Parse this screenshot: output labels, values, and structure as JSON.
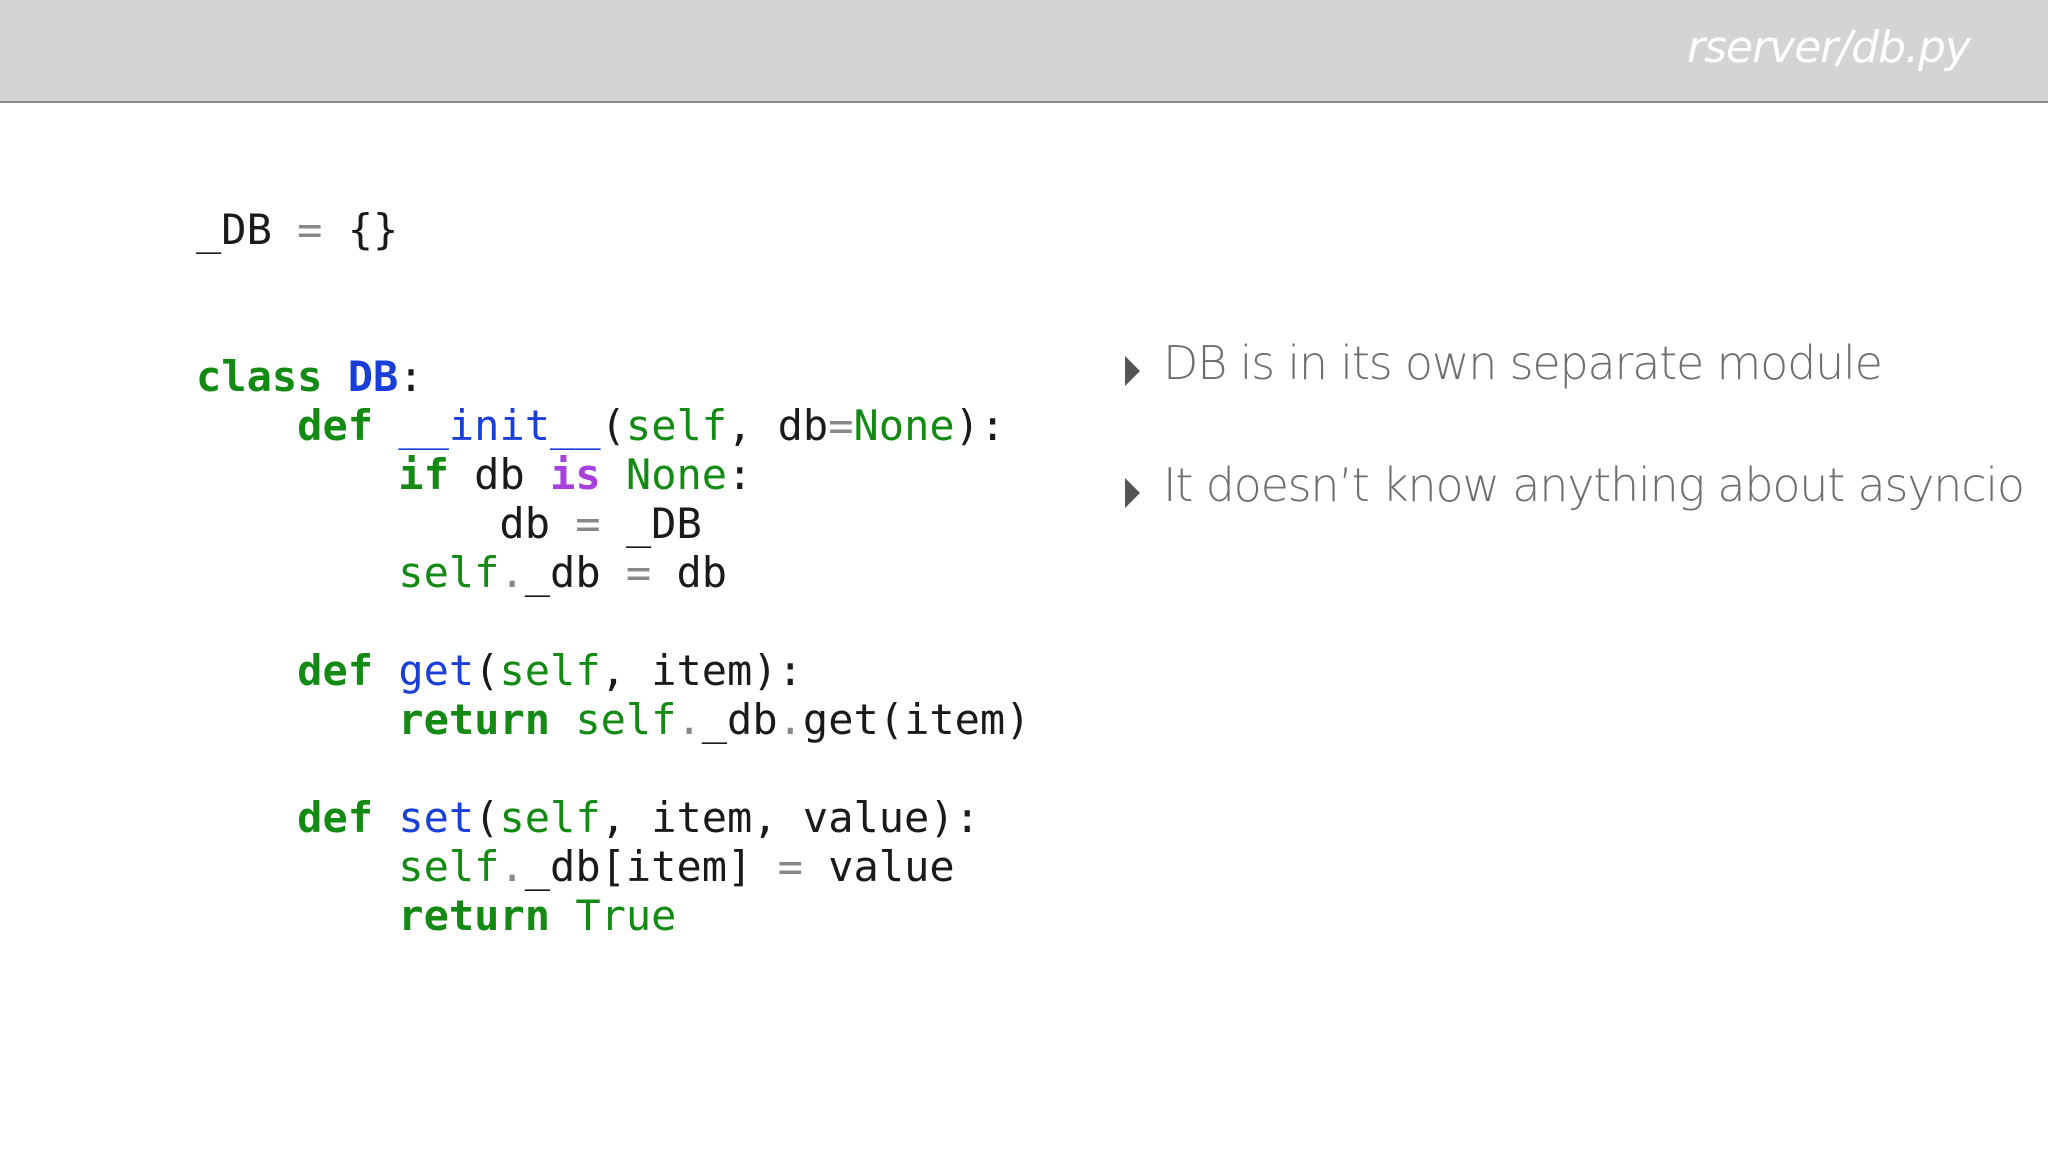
{
  "header": {
    "file_path": "rserver/db.py"
  },
  "code": {
    "language": "python",
    "lines": [
      [
        {
          "t": "_DB",
          "k": "var"
        },
        {
          "t": " ",
          "k": "var"
        },
        {
          "t": "=",
          "k": "op"
        },
        {
          "t": " {}",
          "k": "pun"
        }
      ],
      [],
      [],
      [
        {
          "t": "class",
          "k": "kw"
        },
        {
          "t": " ",
          "k": "var"
        },
        {
          "t": "DB",
          "k": "cls"
        },
        {
          "t": ":",
          "k": "pun"
        }
      ],
      [
        {
          "t": "    ",
          "k": "var"
        },
        {
          "t": "def",
          "k": "kw"
        },
        {
          "t": " ",
          "k": "var"
        },
        {
          "t": "__init__",
          "k": "fn"
        },
        {
          "t": "(",
          "k": "pun"
        },
        {
          "t": "self",
          "k": "bi"
        },
        {
          "t": ", db",
          "k": "pun"
        },
        {
          "t": "=",
          "k": "op"
        },
        {
          "t": "None",
          "k": "bi"
        },
        {
          "t": "):",
          "k": "pun"
        }
      ],
      [
        {
          "t": "        ",
          "k": "var"
        },
        {
          "t": "if",
          "k": "kw"
        },
        {
          "t": " db ",
          "k": "var"
        },
        {
          "t": "is",
          "k": "opw"
        },
        {
          "t": " ",
          "k": "var"
        },
        {
          "t": "None",
          "k": "bi"
        },
        {
          "t": ":",
          "k": "pun"
        }
      ],
      [
        {
          "t": "            db ",
          "k": "var"
        },
        {
          "t": "=",
          "k": "op"
        },
        {
          "t": " _DB",
          "k": "var"
        }
      ],
      [
        {
          "t": "        ",
          "k": "var"
        },
        {
          "t": "self",
          "k": "bi"
        },
        {
          "t": ".",
          "k": "op"
        },
        {
          "t": "_db ",
          "k": "var"
        },
        {
          "t": "=",
          "k": "op"
        },
        {
          "t": " db",
          "k": "var"
        }
      ],
      [],
      [
        {
          "t": "    ",
          "k": "var"
        },
        {
          "t": "def",
          "k": "kw"
        },
        {
          "t": " ",
          "k": "var"
        },
        {
          "t": "get",
          "k": "fn"
        },
        {
          "t": "(",
          "k": "pun"
        },
        {
          "t": "self",
          "k": "bi"
        },
        {
          "t": ", item):",
          "k": "pun"
        }
      ],
      [
        {
          "t": "        ",
          "k": "var"
        },
        {
          "t": "return",
          "k": "kw"
        },
        {
          "t": " ",
          "k": "var"
        },
        {
          "t": "self",
          "k": "bi"
        },
        {
          "t": ".",
          "k": "op"
        },
        {
          "t": "_db",
          "k": "var"
        },
        {
          "t": ".",
          "k": "op"
        },
        {
          "t": "get(item)",
          "k": "var"
        }
      ],
      [],
      [
        {
          "t": "    ",
          "k": "var"
        },
        {
          "t": "def",
          "k": "kw"
        },
        {
          "t": " ",
          "k": "var"
        },
        {
          "t": "set",
          "k": "fn"
        },
        {
          "t": "(",
          "k": "pun"
        },
        {
          "t": "self",
          "k": "bi"
        },
        {
          "t": ", item, value):",
          "k": "pun"
        }
      ],
      [
        {
          "t": "        ",
          "k": "var"
        },
        {
          "t": "self",
          "k": "bi"
        },
        {
          "t": ".",
          "k": "op"
        },
        {
          "t": "_db[item] ",
          "k": "var"
        },
        {
          "t": "=",
          "k": "op"
        },
        {
          "t": " value",
          "k": "var"
        }
      ],
      [
        {
          "t": "        ",
          "k": "var"
        },
        {
          "t": "return",
          "k": "kw"
        },
        {
          "t": " ",
          "k": "var"
        },
        {
          "t": "True",
          "k": "bi"
        }
      ]
    ]
  },
  "bullets": {
    "items": [
      {
        "text": "DB is in its own separate module"
      },
      {
        "text": "It doesn’t know anything about asyncio"
      }
    ]
  },
  "colors": {
    "keyword": "#138a13",
    "function_name": "#1a3fd8",
    "operator": "#888888",
    "operator_word": "#a840e0",
    "builtin": "#138a13",
    "header_bg": "#d4d4d4",
    "bullet_text": "#6e6e6e"
  },
  "icons": {
    "bullet_marker": "triangle-right-icon"
  }
}
